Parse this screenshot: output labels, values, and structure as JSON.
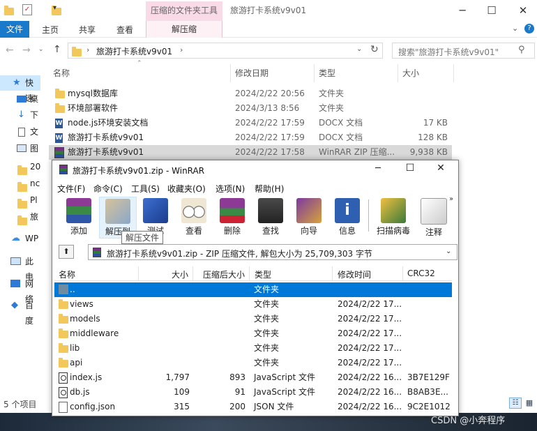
{
  "explorer": {
    "context_tab": "压缩的文件夹工具",
    "ribbon_tabs": [
      "文件",
      "主页",
      "共享",
      "查看"
    ],
    "context_subtab": "解压缩",
    "window_title": "旅游打卡系统v9v01",
    "breadcrumb": "旅游打卡系统v9v01",
    "search_placeholder": "搜索\"旅游打卡系统v9v01\"",
    "columns": {
      "name": "名称",
      "date": "修改日期",
      "type": "类型",
      "size": "大小"
    },
    "files": [
      {
        "name": "mysql数据库",
        "date": "2024/2/22 20:56",
        "type": "文件夹",
        "size": "",
        "icon": "folder-icon"
      },
      {
        "name": "环境部署软件",
        "date": "2024/3/13 8:56",
        "type": "文件夹",
        "size": "",
        "icon": "folder-icon"
      },
      {
        "name": "node.js环境安装文档",
        "date": "2024/2/22 17:59",
        "type": "DOCX 文档",
        "size": "17 KB",
        "icon": "docx-icon"
      },
      {
        "name": "旅游打卡系统v9v01",
        "date": "2024/2/22 17:59",
        "type": "DOCX 文档",
        "size": "128 KB",
        "icon": "docx-icon"
      },
      {
        "name": "旅游打卡系统v9v01",
        "date": "2024/2/22 17:58",
        "type": "WinRAR ZIP 压缩...",
        "size": "9,938 KB",
        "icon": "rar-icon"
      }
    ],
    "sidebar": [
      "快速",
      "桌",
      "下",
      "文",
      "图",
      "20",
      "nc",
      "Pl",
      "旅",
      "WP",
      "此电",
      "网络",
      "百度"
    ],
    "status": "5 个项目",
    "watermark": "CSDN @小奔程序"
  },
  "winrar": {
    "title": "旅游打卡系统v9v01.zip - WinRAR",
    "menu": [
      "文件(F)",
      "命令(C)",
      "工具(S)",
      "收藏夹(O)",
      "选项(N)",
      "帮助(H)"
    ],
    "tools": [
      "添加",
      "解压到",
      "测试",
      "查看",
      "删除",
      "查找",
      "向导",
      "信息",
      "扫描病毒",
      "注释"
    ],
    "tooltip": "解压文件",
    "path_text": "旅游打卡系统v9v01.zip - ZIP 压缩文件, 解包大小为 25,709,303 字节",
    "columns": {
      "name": "名称",
      "size": "大小",
      "packed": "压缩后大小",
      "type": "类型",
      "modified": "修改时间",
      "crc": "CRC32"
    },
    "rows": [
      {
        "name": "..",
        "size": "",
        "packed": "",
        "type": "文件夹",
        "modified": "",
        "crc": "",
        "icon": "folder-up-icon"
      },
      {
        "name": "views",
        "size": "",
        "packed": "",
        "type": "文件夹",
        "modified": "2024/2/22 17...",
        "crc": "",
        "icon": "folder-icon"
      },
      {
        "name": "models",
        "size": "",
        "packed": "",
        "type": "文件夹",
        "modified": "2024/2/22 17...",
        "crc": "",
        "icon": "folder-icon"
      },
      {
        "name": "middleware",
        "size": "",
        "packed": "",
        "type": "文件夹",
        "modified": "2024/2/22 17...",
        "crc": "",
        "icon": "folder-icon"
      },
      {
        "name": "lib",
        "size": "",
        "packed": "",
        "type": "文件夹",
        "modified": "2024/2/22 17...",
        "crc": "",
        "icon": "folder-icon"
      },
      {
        "name": "api",
        "size": "",
        "packed": "",
        "type": "文件夹",
        "modified": "2024/2/22 17...",
        "crc": "",
        "icon": "folder-icon"
      },
      {
        "name": "index.js",
        "size": "1,797",
        "packed": "893",
        "type": "JavaScript 文件",
        "modified": "2024/2/22 16...",
        "crc": "3B7E129F",
        "icon": "js-file-icon"
      },
      {
        "name": "db.js",
        "size": "109",
        "packed": "91",
        "type": "JavaScript 文件",
        "modified": "2024/2/22 16...",
        "crc": "B8AB3E...",
        "icon": "js-file-icon"
      },
      {
        "name": "config.json",
        "size": "315",
        "packed": "200",
        "type": "JSON 文件",
        "modified": "2024/2/22 16...",
        "crc": "9C2E1012",
        "icon": "json-file-icon"
      }
    ]
  }
}
